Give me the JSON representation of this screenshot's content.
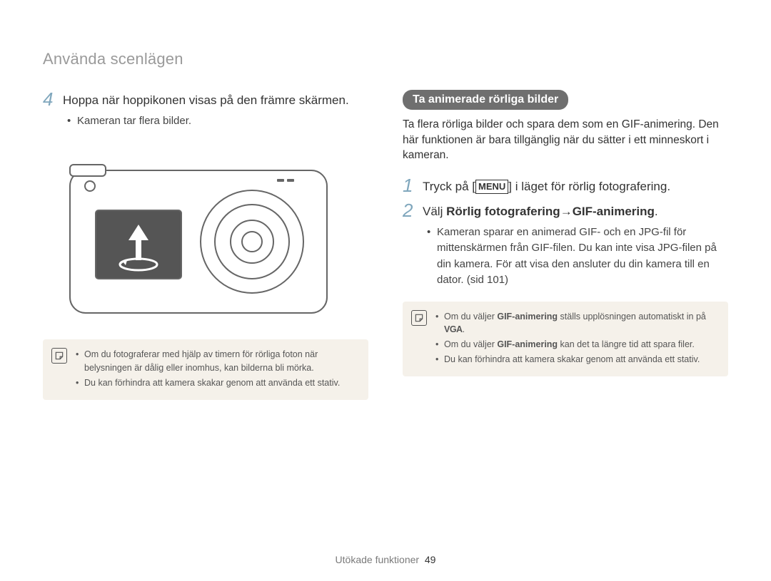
{
  "breadcrumb": "Använda scenlägen",
  "left": {
    "step4": {
      "num": "4",
      "text": "Hoppa när hoppikonen visas på den främre skärmen.",
      "bullets": [
        "Kameran tar flera bilder."
      ]
    },
    "notes": [
      "Om du fotograferar med hjälp av timern för rörliga foton när belysningen är dålig eller inomhus, kan bilderna bli mörka.",
      "Du kan förhindra att kamera skakar genom att använda ett stativ."
    ]
  },
  "right": {
    "pill": "Ta animerade rörliga bilder",
    "intro": "Ta flera rörliga bilder och spara dem som en GIF-animering. Den här funktionen är bara tillgänglig när du sätter i ett minneskort i kameran.",
    "step1": {
      "num": "1",
      "pre": "Tryck på [",
      "menu": "MENU",
      "post": "] i läget för rörlig fotografering."
    },
    "step2": {
      "num": "2",
      "pre": "Välj ",
      "bold1": "Rörlig fotografering",
      "arrow": " → ",
      "bold2": "GIF-animering",
      "post": ".",
      "bullets": [
        "Kameran sparar en animerad GIF- och en JPG-fil för mittenskärmen från GIF-filen. Du kan inte visa JPG-filen på din kamera. För att visa den ansluter du din kamera till en dator. (sid 101)"
      ]
    },
    "notes": {
      "n1_pre": "Om du väljer ",
      "n1_bold": "GIF-animering",
      "n1_mid": " ställs upplösningen automatiskt in på ",
      "n1_vga": "VGA",
      "n1_post": ".",
      "n2_pre": "Om du väljer ",
      "n2_bold": "GIF-animering",
      "n2_post": " kan det ta längre tid att spara filer.",
      "n3": "Du kan förhindra att kamera skakar genom att använda ett stativ."
    }
  },
  "footer": {
    "section": "Utökade funktioner",
    "page": "49"
  }
}
